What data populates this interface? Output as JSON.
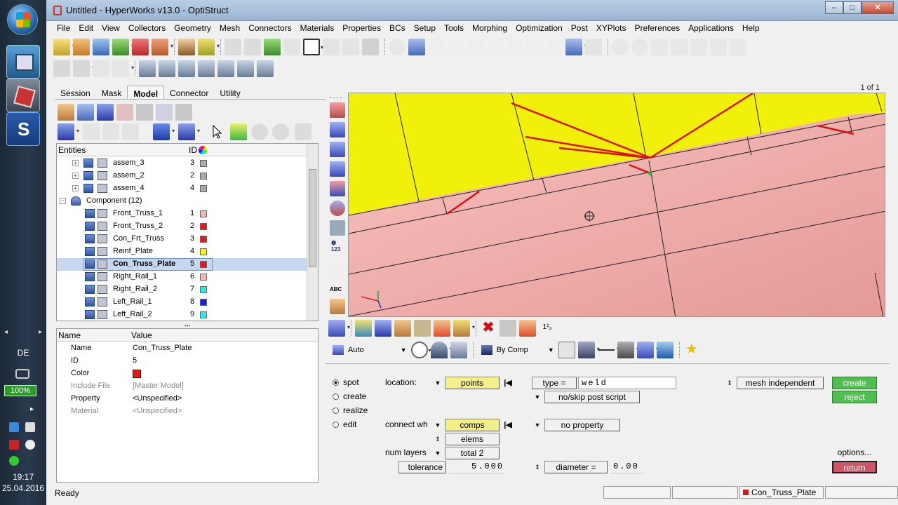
{
  "app": {
    "title": "Untitled - HyperWorks v13.0 - OptiStruct",
    "page_indicator": "1 of 1"
  },
  "menu": [
    "File",
    "Edit",
    "View",
    "Collectors",
    "Geometry",
    "Mesh",
    "Connectors",
    "Materials",
    "Properties",
    "BCs",
    "Setup",
    "Tools",
    "Morphing",
    "Optimization",
    "Post",
    "XYPlots",
    "Preferences",
    "Applications",
    "Help"
  ],
  "tabs": [
    "Session",
    "Mask",
    "Model",
    "Connector",
    "Utility"
  ],
  "active_tab": "Model",
  "entities": {
    "header_name": "Entities",
    "header_id": "ID",
    "rows": [
      {
        "name": "assem_3",
        "id": "3",
        "color": "#a9a9a9",
        "type": "assem",
        "indent": 1
      },
      {
        "name": "assem_2",
        "id": "2",
        "color": "#a9a9a9",
        "type": "assem",
        "indent": 1
      },
      {
        "name": "assem_4",
        "id": "4",
        "color": "#a9a9a9",
        "type": "assem",
        "indent": 1
      },
      {
        "name": "Component (12)",
        "id": "",
        "color": "",
        "type": "group",
        "indent": 0
      },
      {
        "name": "Front_Truss_1",
        "id": "1",
        "color": "#f3b6b6",
        "type": "comp",
        "indent": 1
      },
      {
        "name": "Front_Truss_2",
        "id": "2",
        "color": "#e41a1a",
        "type": "comp",
        "indent": 1
      },
      {
        "name": "Con_Frt_Truss",
        "id": "3",
        "color": "#e41a1a",
        "type": "comp",
        "indent": 1
      },
      {
        "name": "Reinf_Plate",
        "id": "4",
        "color": "#f2f20f",
        "type": "comp",
        "indent": 1
      },
      {
        "name": "Con_Truss_Plate",
        "id": "5",
        "color": "#e41a1a",
        "type": "comp",
        "indent": 1,
        "selected": true
      },
      {
        "name": "Right_Rail_1",
        "id": "6",
        "color": "#f3b6b6",
        "type": "comp",
        "indent": 1
      },
      {
        "name": "Right_Rail_2",
        "id": "7",
        "color": "#33e6e6",
        "type": "comp",
        "indent": 1
      },
      {
        "name": "Left_Rail_1",
        "id": "8",
        "color": "#1a1ae6",
        "type": "comp",
        "indent": 1
      },
      {
        "name": "Left_Rail_2",
        "id": "9",
        "color": "#33e6e6",
        "type": "comp",
        "indent": 1
      }
    ]
  },
  "properties": {
    "header_name": "Name",
    "header_value": "Value",
    "rows": [
      {
        "name": "Name",
        "value": "Con_Truss_Plate",
        "dim": false
      },
      {
        "name": "ID",
        "value": "5",
        "dim": false
      },
      {
        "name": "Color",
        "value": "",
        "dim": false,
        "swatch": "#e41a1a"
      },
      {
        "name": "Include File",
        "value": "[Master Model]",
        "dim": true
      },
      {
        "name": "Property",
        "value": "<Unspecified>",
        "dim": false
      },
      {
        "name": "Material",
        "value": "<Unspecified>",
        "dim": true
      }
    ]
  },
  "toolbar2": {
    "auto_label": "Auto",
    "bycomp_label": "By Comp"
  },
  "panel": {
    "modes": [
      "spot",
      "create",
      "realize",
      "edit"
    ],
    "active_mode": "spot",
    "location_label": "location:",
    "location_value": "points",
    "connect_label": "connect wh",
    "connect_value": "comps",
    "elems_label": "elems",
    "num_layers_label": "num layers",
    "num_layers_value": "total 2",
    "tolerance_label": "tolerance",
    "tolerance_value": "5.000",
    "type_label": "type =",
    "type_value": "weld",
    "post_script": "no/skip post script",
    "property": "no property",
    "diameter_label": "diameter =",
    "diameter_value": "0.00",
    "mesh_mode": "mesh independent",
    "create": "create",
    "reject": "reject",
    "options": "options...",
    "return": "return"
  },
  "status": {
    "text": "Ready",
    "component": "Con_Truss_Plate",
    "component_color": "#d11a1a"
  },
  "taskbar": {
    "language": "DE",
    "battery": "100%",
    "time": "19:17",
    "date": "25.04.2016"
  },
  "colors": {
    "yellow_plate": "#f0f00a",
    "pink_rail": "#f3b0ae",
    "weld_line": "#e01010"
  }
}
